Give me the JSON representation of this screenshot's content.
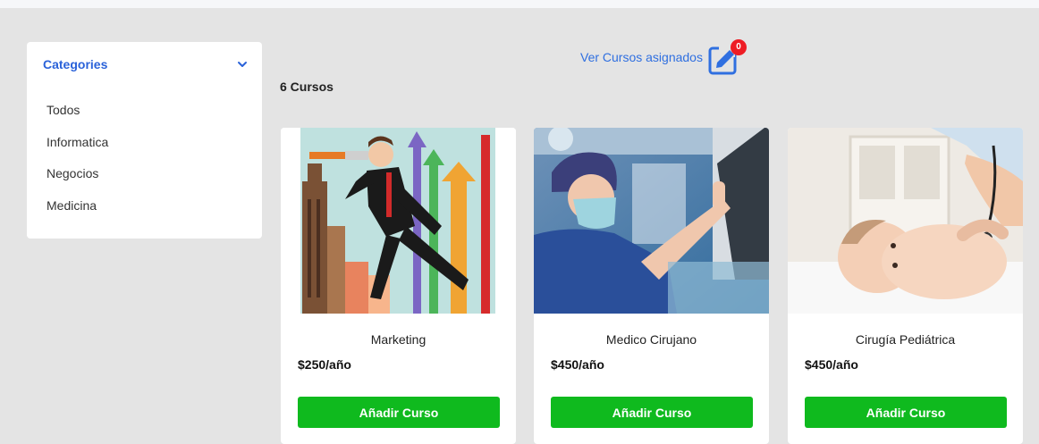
{
  "sidebar": {
    "title": "Categories",
    "categories": [
      "Todos",
      "Informatica",
      "Negocios",
      "Medicina"
    ]
  },
  "header": {
    "assigned_link": "Ver Cursos asignados",
    "badge_count": "0"
  },
  "course_count": "6 Cursos",
  "courses": [
    {
      "name": "Marketing",
      "price": "$250/año",
      "button": "Añadir Curso",
      "image": "marketing-illustration"
    },
    {
      "name": "Medico Cirujano",
      "price": "$450/año",
      "button": "Añadir Curso",
      "image": "surgeon-photo"
    },
    {
      "name": "Cirugía Pediátrica",
      "price": "$450/año",
      "button": "Añadir Curso",
      "image": "baby-stethoscope-photo"
    }
  ],
  "colors": {
    "accent": "#2a62d9",
    "button": "#0fba1e",
    "badge": "#ee1c24",
    "background": "#e4e4e4"
  }
}
